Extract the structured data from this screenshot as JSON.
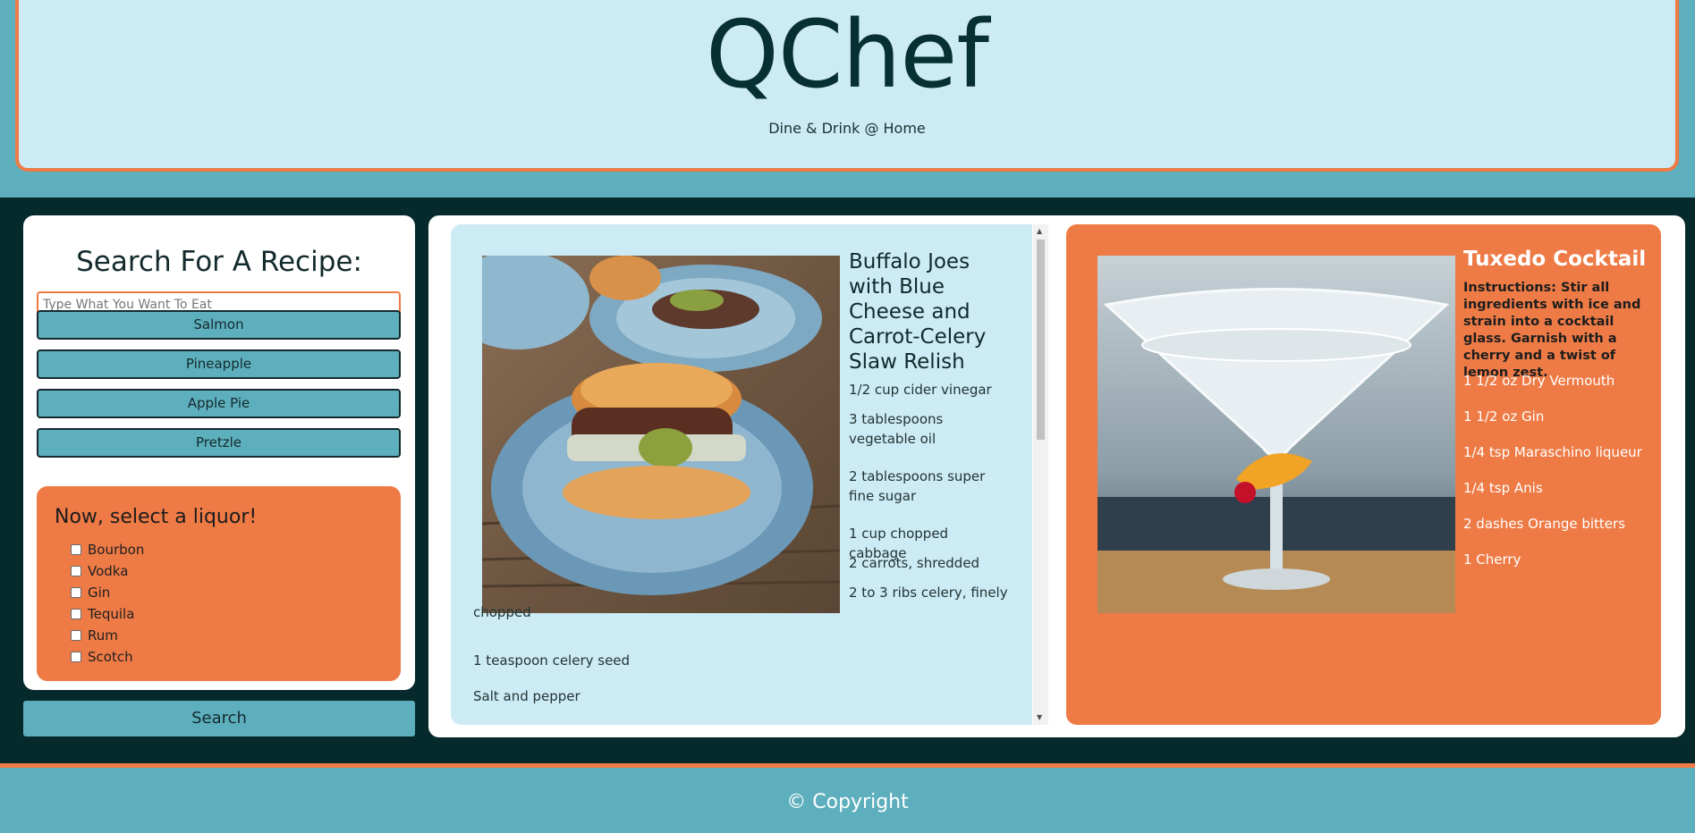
{
  "header": {
    "brand": "QChef",
    "tagline": "Dine & Drink @ Home"
  },
  "sidebar": {
    "title": "Search For A Recipe:",
    "search_placeholder": "Type What You Want To Eat",
    "quick_buttons": [
      "Salmon",
      "Pineapple",
      "Apple Pie",
      "Pretzle"
    ],
    "liquor_title": "Now, select a liquor!",
    "liquors": [
      "Bourbon",
      "Vodka",
      "Gin",
      "Tequila",
      "Rum",
      "Scotch"
    ],
    "search_button": "Search"
  },
  "recipe": {
    "title": "Buffalo Joes with Blue Cheese and Carrot-Celery Slaw Relish",
    "ingredients": [
      "1/2 cup cider vinegar",
      "3 tablespoons vegetable oil",
      "2 tablespoons super fine sugar",
      "1 cup chopped cabbage",
      "2 carrots, shredded",
      "2 to 3 ribs celery, finely chopped",
      "1 teaspoon celery seed",
      "Salt and pepper"
    ]
  },
  "cocktail": {
    "title": "Tuxedo Cocktail",
    "instructions": "Instructions: Stir all ingredients with ice and strain into a cocktail glass. Garnish with a cherry and a twist of lemon zest.",
    "ingredients": [
      "1 1/2 oz Dry Vermouth",
      "1 1/2 oz Gin",
      "1/4 tsp Maraschino liqueur",
      "1/4 tsp Anis",
      "2 dashes Orange bitters",
      "1 Cherry"
    ]
  },
  "footer": {
    "copyright": "© Copyright"
  },
  "colors": {
    "teal": "#5eafbd",
    "orange": "#ee7b46",
    "light_blue": "#cdebf4",
    "dark": "#062a2c"
  }
}
